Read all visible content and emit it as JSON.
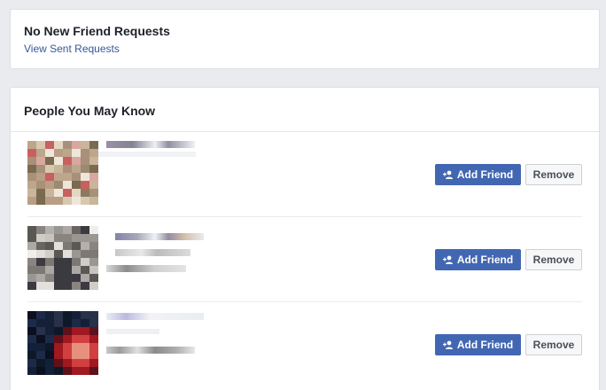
{
  "friend_requests": {
    "title": "No New Friend Requests",
    "view_sent_link": "View Sent Requests"
  },
  "pymk": {
    "title": "People You May Know",
    "people": [
      {
        "add_label": "Add Friend",
        "remove_label": "Remove"
      },
      {
        "add_label": "Add Friend",
        "remove_label": "Remove"
      },
      {
        "add_label": "Add Friend",
        "remove_label": "Remove"
      }
    ]
  },
  "colors": {
    "accent": "#4267b2",
    "link": "#365899",
    "background": "#e9ebee"
  },
  "icons": {
    "add_friend": "person-plus-icon"
  }
}
